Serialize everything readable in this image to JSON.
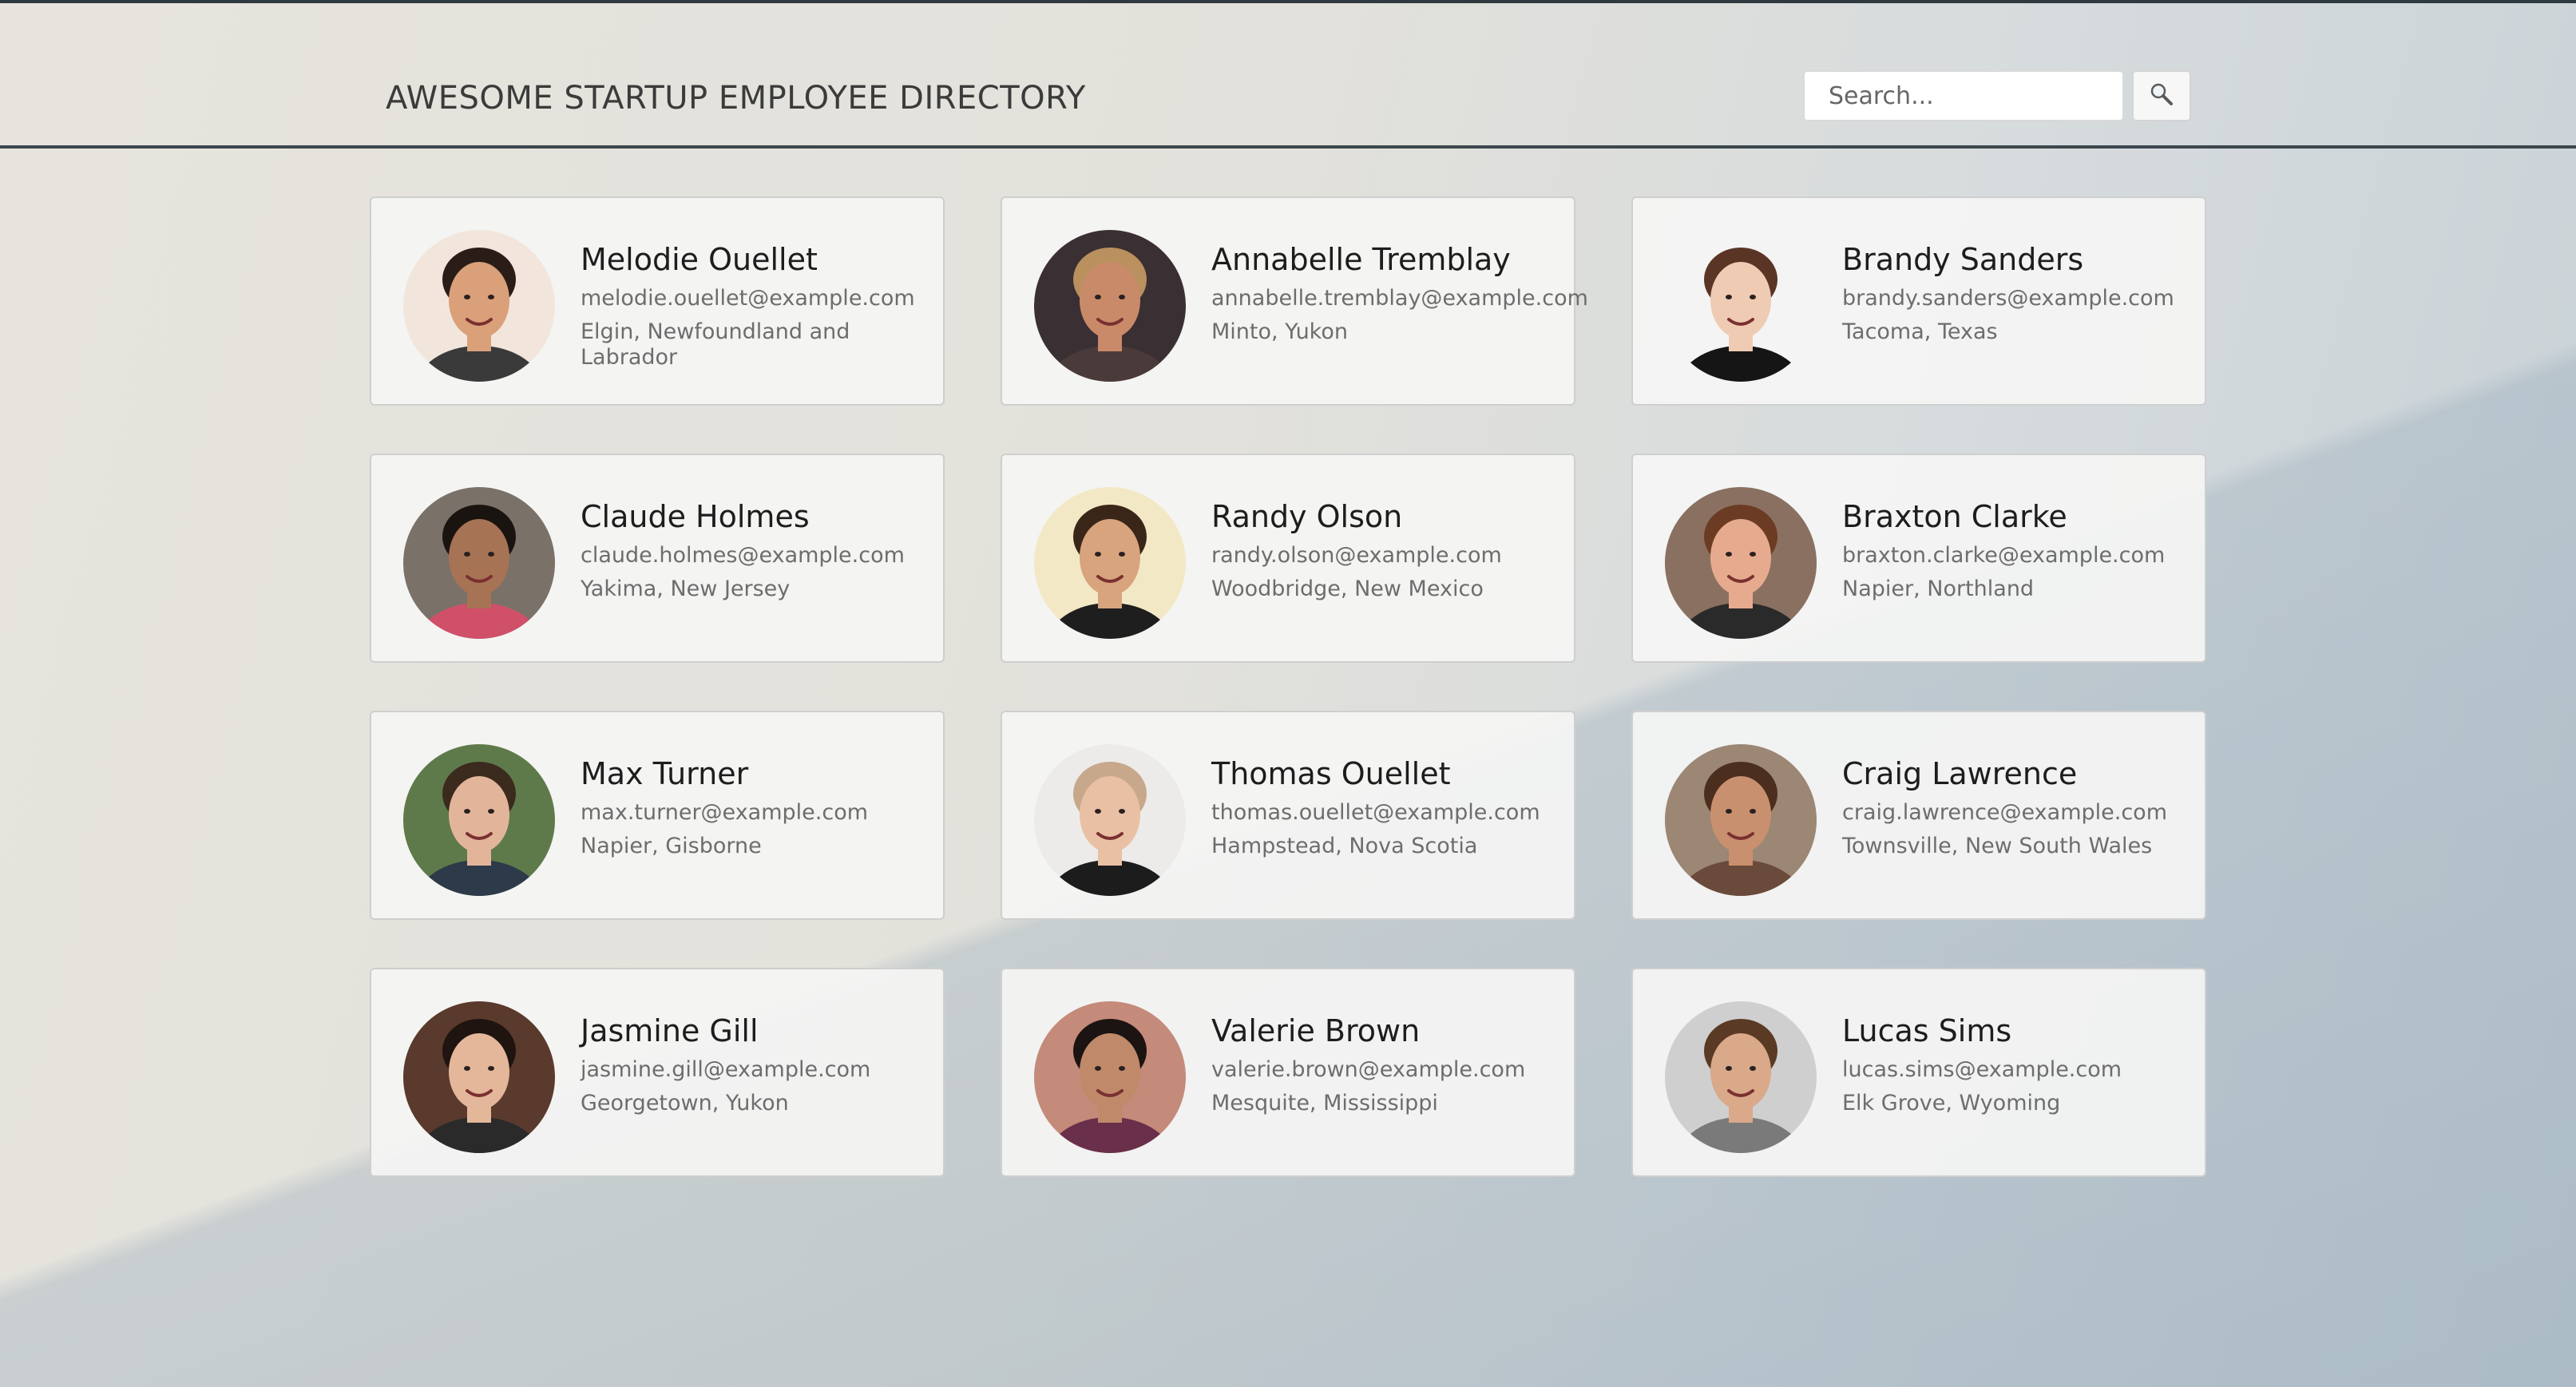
{
  "header": {
    "title": "AWESOME STARTUP EMPLOYEE DIRECTORY",
    "search_placeholder": "Search...",
    "search_icon": "magnifier-icon"
  },
  "employees": [
    {
      "name": "Melodie Ouellet",
      "email": "melodie.ouellet@example.com",
      "location": "Elgin, Newfoundland and Labrador",
      "skin": "#d9a07a",
      "hair": "#2a1d18",
      "shirt": "#3a3a3a",
      "bg": "#f2e6dc"
    },
    {
      "name": "Annabelle Tremblay",
      "email": "annabelle.tremblay@example.com",
      "location": "Minto, Yukon",
      "skin": "#c98a6a",
      "hair": "#b9905e",
      "shirt": "#4a3b3a",
      "bg": "#3a2f33"
    },
    {
      "name": "Brandy Sanders",
      "email": "brandy.sanders@example.com",
      "location": "Tacoma, Texas",
      "skin": "#f0cbb3",
      "hair": "#5a3526",
      "shirt": "#151515",
      "bg": "#f4f4f4"
    },
    {
      "name": "Claude Holmes",
      "email": "claude.holmes@example.com",
      "location": "Yakima, New Jersey",
      "skin": "#a77355",
      "hair": "#1a1410",
      "shirt": "#d0506a",
      "bg": "#7a7168"
    },
    {
      "name": "Randy Olson",
      "email": "randy.olson@example.com",
      "location": "Woodbridge, New Mexico",
      "skin": "#d8a47e",
      "hair": "#3a2618",
      "shirt": "#1e1e1e",
      "bg": "#f3e8c6"
    },
    {
      "name": "Braxton Clarke",
      "email": "braxton.clarke@example.com",
      "location": "Napier, Northland",
      "skin": "#e6ab8e",
      "hair": "#6b3c23",
      "shirt": "#2a2a2a",
      "bg": "#8a7060"
    },
    {
      "name": "Max Turner",
      "email": "max.turner@example.com",
      "location": "Napier, Gisborne",
      "skin": "#e2b59a",
      "hair": "#3b2a1e",
      "shirt": "#2c3a4a",
      "bg": "#5f7a4a"
    },
    {
      "name": "Thomas Ouellet",
      "email": "thomas.ouellet@example.com",
      "location": "Hampstead, Nova Scotia",
      "skin": "#eac0a4",
      "hair": "#c7a88a",
      "shirt": "#1c1c1c",
      "bg": "#ecebea"
    },
    {
      "name": "Craig Lawrence",
      "email": "craig.lawrence@example.com",
      "location": "Townsville, New South Wales",
      "skin": "#c8906e",
      "hair": "#4b2e1d",
      "shirt": "#6a4a3a",
      "bg": "#9c8674"
    },
    {
      "name": "Jasmine Gill",
      "email": "jasmine.gill@example.com",
      "location": "Georgetown, Yukon",
      "skin": "#e5b79a",
      "hair": "#1f1410",
      "shirt": "#2a2a2a",
      "bg": "#5a3a2c"
    },
    {
      "name": "Valerie Brown",
      "email": "valerie.brown@example.com",
      "location": "Mesquite, Mississippi",
      "skin": "#c08a6a",
      "hair": "#1c1412",
      "shirt": "#6a2f4a",
      "bg": "#c48a7a"
    },
    {
      "name": "Lucas Sims",
      "email": "lucas.sims@example.com",
      "location": "Elk Grove, Wyoming",
      "skin": "#d9a98a",
      "hair": "#5a3a24",
      "shirt": "#7a7a7a",
      "bg": "#cfcfcf"
    }
  ]
}
